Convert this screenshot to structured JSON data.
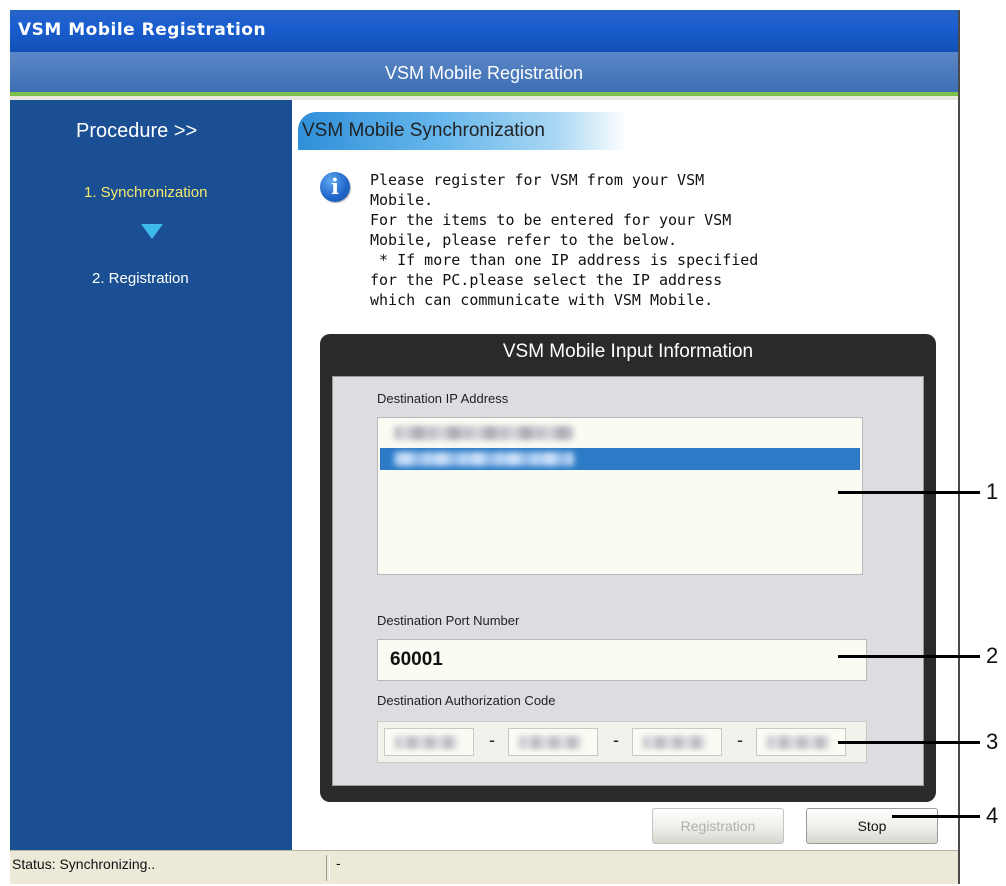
{
  "window": {
    "title": "VSM Mobile Registration"
  },
  "header": {
    "title": "VSM Mobile Registration"
  },
  "sidebar": {
    "procedure_title": "Procedure >>",
    "steps": [
      {
        "label": "1. Synchronization",
        "active": true
      },
      {
        "label": "2. Registration",
        "active": false
      }
    ],
    "arrow_icon": "down-triangle-icon"
  },
  "content": {
    "section_title": "VSM Mobile Synchronization",
    "info_icon": "info-icon",
    "info_text": "Please register for VSM from your VSM\nMobile.\nFor the items to be entered for your VSM\nMobile, please refer to the below.\n * If more than one IP address is specified\nfor the PC.please select the IP address\nwhich can communicate with VSM Mobile.",
    "panel": {
      "title": "VSM Mobile Input Information",
      "ip_label": "Destination IP Address",
      "port_label": "Destination Port Number",
      "port_value": "60001",
      "auth_label": "Destination Authorization Code",
      "auth_separators": [
        "-",
        "-",
        "-"
      ]
    }
  },
  "buttons": {
    "registration": "Registration",
    "stop": "Stop"
  },
  "status": {
    "left": "Status: Synchronizing..",
    "right": "-"
  },
  "callouts": [
    "1",
    "2",
    "3",
    "4"
  ],
  "colors": {
    "titlebar": "#195ecf",
    "sidebar": "#1b4f93",
    "active_step": "#f5e96a",
    "selection": "#2d7bc7",
    "accent_line": "#7fbf4d"
  }
}
